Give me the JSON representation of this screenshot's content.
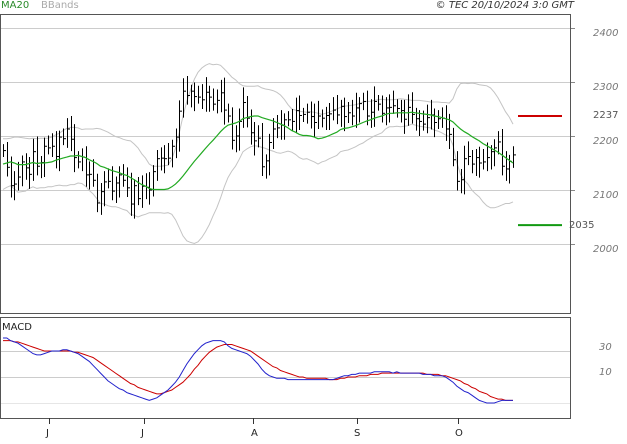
{
  "legend": {
    "ma": "MA20",
    "bands": "BBands"
  },
  "copyright": "© TEC 20/10/2024 3:0 GMT",
  "macd_label": "MACD",
  "chart_data": [
    {
      "type": "line",
      "subtype": "ohlc-bars",
      "title": "",
      "y_ticks": [
        "2000",
        "2100",
        "2200",
        "2300",
        "2400"
      ],
      "ylim": [
        1950,
        2440
      ],
      "x_ticks": [
        "J",
        "J",
        "A",
        "S",
        "O"
      ],
      "grid": true,
      "legend_position": "top-left",
      "levels": [
        {
          "label": "2237",
          "value": 2237,
          "color": "#cc0000"
        },
        {
          "label": "2035",
          "value": 2035,
          "color": "#119911"
        }
      ],
      "colors": {
        "bars": "#000000",
        "ma20": "#22aa22",
        "bbands": "#bbbbbb",
        "resistance": "#cc0000",
        "support": "#119911"
      },
      "close": [
        2173,
        2142,
        2108,
        2111,
        2124,
        2152,
        2141,
        2129,
        2171,
        2144,
        2151,
        2181,
        2178,
        2181,
        2162,
        2198,
        2195,
        2213,
        2194,
        2160,
        2152,
        2161,
        2128,
        2129,
        2118,
        2076,
        2097,
        2115,
        2116,
        2098,
        2113,
        2128,
        2118,
        2104,
        2074,
        2108,
        2084,
        2107,
        2105,
        2100,
        2134,
        2158,
        2159,
        2158,
        2159,
        2181,
        2198,
        2246,
        2283,
        2275,
        2283,
        2273,
        2272,
        2267,
        2281,
        2272,
        2259,
        2266,
        2280,
        2248,
        2237,
        2192,
        2200,
        2227,
        2262,
        2233,
        2206,
        2191,
        2196,
        2143,
        2154,
        2188,
        2213,
        2215,
        2220,
        2230,
        2230,
        2227,
        2247,
        2238,
        2240,
        2244,
        2236,
        2225,
        2237,
        2233,
        2238,
        2241,
        2248,
        2239,
        2255,
        2236,
        2243,
        2237,
        2252,
        2260,
        2264,
        2237,
        2244,
        2264,
        2259,
        2242,
        2252,
        2253,
        2256,
        2251,
        2247,
        2231,
        2253,
        2240,
        2232,
        2227,
        2222,
        2234,
        2239,
        2225,
        2232,
        2233,
        2213,
        2203,
        2156,
        2116,
        2119,
        2158,
        2162,
        2148,
        2160,
        2150,
        2152,
        2160,
        2171,
        2178,
        2189,
        2144,
        2139,
        2153,
        2165
      ],
      "ma20": [
        2148,
        2150,
        2152,
        2150,
        2147,
        2147,
        2147,
        2149,
        2151,
        2149,
        2150,
        2150,
        2151,
        2152,
        2155,
        2157,
        2159,
        2161,
        2163,
        2163,
        2164,
        2162,
        2160,
        2156,
        2153,
        2149,
        2144,
        2142,
        2139,
        2136,
        2134,
        2132,
        2129,
        2127,
        2123,
        2119,
        2114,
        2110,
        2107,
        2103,
        2101,
        2101,
        2101,
        2101,
        2102,
        2106,
        2111,
        2118,
        2126,
        2135,
        2144,
        2153,
        2161,
        2169,
        2177,
        2185,
        2192,
        2200,
        2208,
        2215,
        2220,
        2222,
        2224,
        2227,
        2232,
        2234,
        2236,
        2237,
        2237,
        2234,
        2232,
        2230,
        2228,
        2225,
        2222,
        2219,
        2215,
        2210,
        2207,
        2203,
        2201,
        2201,
        2200,
        2198,
        2195,
        2196,
        2198,
        2201,
        2204,
        2207,
        2212,
        2214,
        2215,
        2217,
        2219,
        2222,
        2225,
        2228,
        2230,
        2233,
        2235,
        2237,
        2240,
        2242,
        2242,
        2243,
        2243,
        2243,
        2243,
        2244,
        2243,
        2242,
        2241,
        2240,
        2239,
        2237,
        2236,
        2234,
        2232,
        2230,
        2226,
        2219,
        2213,
        2208,
        2204,
        2199,
        2195,
        2191,
        2186,
        2182,
        2178,
        2174,
        2170,
        2165,
        2160,
        2155,
        2150
      ],
      "bb_upper": [
        2195,
        2195,
        2196,
        2198,
        2198,
        2197,
        2196,
        2195,
        2196,
        2195,
        2196,
        2196,
        2196,
        2198,
        2202,
        2205,
        2210,
        2214,
        2216,
        2216,
        2215,
        2212,
        2213,
        2213,
        2213,
        2214,
        2213,
        2210,
        2207,
        2203,
        2199,
        2197,
        2194,
        2192,
        2191,
        2185,
        2178,
        2167,
        2159,
        2148,
        2144,
        2144,
        2144,
        2145,
        2146,
        2157,
        2177,
        2206,
        2237,
        2264,
        2285,
        2305,
        2318,
        2326,
        2331,
        2334,
        2332,
        2333,
        2331,
        2324,
        2317,
        2309,
        2304,
        2297,
        2293,
        2292,
        2292,
        2292,
        2293,
        2289,
        2287,
        2286,
        2284,
        2281,
        2276,
        2268,
        2258,
        2250,
        2248,
        2246,
        2245,
        2244,
        2245,
        2244,
        2242,
        2240,
        2242,
        2244,
        2247,
        2250,
        2253,
        2255,
        2256,
        2257,
        2258,
        2260,
        2263,
        2264,
        2264,
        2266,
        2267,
        2268,
        2267,
        2267,
        2267,
        2268,
        2269,
        2268,
        2267,
        2266,
        2266,
        2266,
        2265,
        2264,
        2263,
        2263,
        2263,
        2262,
        2262,
        2261,
        2269,
        2287,
        2297,
        2298,
        2297,
        2298,
        2297,
        2295,
        2294,
        2293,
        2289,
        2281,
        2271,
        2258,
        2245,
        2235,
        2222
      ],
      "bb_lower": [
        2101,
        2105,
        2108,
        2102,
        2096,
        2097,
        2098,
        2103,
        2106,
        2103,
        2104,
        2104,
        2106,
        2106,
        2108,
        2109,
        2108,
        2108,
        2110,
        2110,
        2113,
        2112,
        2107,
        2099,
        2093,
        2084,
        2075,
        2074,
        2071,
        2069,
        2069,
        2067,
        2064,
        2062,
        2055,
        2053,
        2050,
        2053,
        2055,
        2058,
        2058,
        2058,
        2058,
        2057,
        2058,
        2055,
        2045,
        2030,
        2015,
        2006,
        2003,
        2001,
        2004,
        2012,
        2023,
        2036,
        2052,
        2067,
        2085,
        2106,
        2123,
        2135,
        2144,
        2157,
        2171,
        2176,
        2180,
        2182,
        2181,
        2179,
        2177,
        2174,
        2172,
        2169,
        2168,
        2170,
        2172,
        2170,
        2166,
        2160,
        2157,
        2158,
        2155,
        2152,
        2148,
        2152,
        2154,
        2158,
        2161,
        2164,
        2171,
        2173,
        2174,
        2177,
        2180,
        2184,
        2187,
        2192,
        2196,
        2200,
        2203,
        2206,
        2213,
        2217,
        2217,
        2218,
        2217,
        2218,
        2219,
        2222,
        2220,
        2218,
        2217,
        2216,
        2215,
        2211,
        2209,
        2206,
        2202,
        2199,
        2183,
        2151,
        2129,
        2118,
        2111,
        2100,
        2093,
        2087,
        2078,
        2071,
        2067,
        2067,
        2069,
        2072,
        2075,
        2075,
        2078
      ]
    },
    {
      "type": "line",
      "title": "MACD",
      "y_ticks": [
        "10",
        "30"
      ],
      "ylim": [
        -27,
        44
      ],
      "grid": true,
      "colors": {
        "macd": "#2222cc",
        "signal": "#cc0000"
      },
      "macd": [
        40,
        40,
        38,
        37,
        36,
        34,
        32,
        30,
        28,
        27,
        27,
        28,
        29,
        30,
        30,
        30,
        31,
        31,
        30,
        29,
        28,
        26,
        24,
        22,
        19,
        16,
        13,
        10,
        7,
        5,
        3,
        1,
        0,
        -2,
        -3,
        -4,
        -5,
        -6,
        -7,
        -8,
        -7,
        -6,
        -4,
        -2,
        0,
        3,
        6,
        10,
        15,
        20,
        24,
        28,
        31,
        34,
        36,
        37,
        38,
        38,
        38,
        37,
        34,
        32,
        31,
        30,
        29,
        28,
        26,
        23,
        20,
        16,
        13,
        11,
        10,
        9,
        9,
        9,
        8,
        8,
        8,
        8,
        8,
        8,
        8,
        8,
        8,
        8,
        8,
        8,
        8,
        9,
        10,
        11,
        11,
        12,
        12,
        13,
        13,
        13,
        13,
        14,
        14,
        14,
        14,
        14,
        13,
        14,
        13,
        13,
        13,
        13,
        13,
        13,
        12,
        12,
        12,
        11,
        11,
        11,
        10,
        8,
        6,
        3,
        1,
        -1,
        -2,
        -4,
        -6,
        -8,
        -9,
        -10,
        -10,
        -10,
        -9,
        -8,
        -8,
        -8,
        -8
      ],
      "signal": [
        38,
        38,
        38,
        37,
        37,
        36,
        35,
        34,
        33,
        32,
        31,
        30,
        30,
        30,
        30,
        30,
        30,
        30,
        30,
        29,
        29,
        28,
        27,
        26,
        25,
        23,
        21,
        19,
        17,
        15,
        13,
        11,
        9,
        7,
        5,
        4,
        2,
        1,
        0,
        -1,
        -2,
        -3,
        -3,
        -2,
        -1,
        0,
        2,
        4,
        6,
        9,
        12,
        16,
        19,
        23,
        26,
        29,
        31,
        33,
        34,
        35,
        35,
        35,
        34,
        33,
        32,
        31,
        30,
        28,
        26,
        24,
        22,
        20,
        18,
        17,
        15,
        14,
        13,
        12,
        11,
        10,
        10,
        9,
        9,
        9,
        9,
        9,
        9,
        8,
        8,
        8,
        9,
        9,
        10,
        10,
        10,
        11,
        11,
        11,
        12,
        12,
        12,
        13,
        13,
        13,
        13,
        13,
        13,
        13,
        13,
        13,
        13,
        13,
        13,
        12,
        12,
        12,
        12,
        11,
        11,
        10,
        9,
        8,
        7,
        5,
        4,
        2,
        1,
        -1,
        -2,
        -3,
        -5,
        -6,
        -7,
        -7,
        -8,
        -8,
        -8
      ]
    }
  ]
}
